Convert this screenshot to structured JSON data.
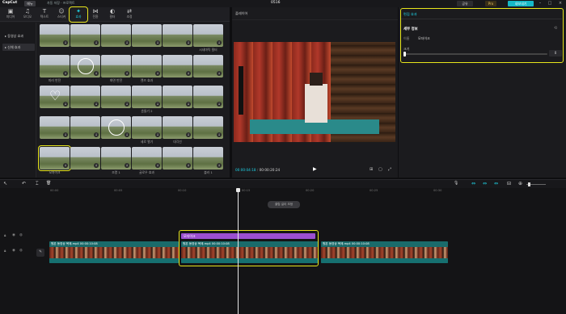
{
  "titlebar": {
    "app_name": "CapCut",
    "menu_label": "메뉴",
    "project_name": "자동 저장 · 프로젝트",
    "window_title": "0516",
    "share_label": "공유",
    "pro_label": "Pro",
    "export_label": "내보내기",
    "minimize": "–",
    "maximize": "□",
    "close": "×"
  },
  "media_tabs": [
    {
      "icon": "▣",
      "label": "미디어"
    },
    {
      "icon": "♫",
      "label": "오디오"
    },
    {
      "icon": "T",
      "label": "텍스트"
    },
    {
      "icon": "☺",
      "label": "스티커"
    },
    {
      "icon": "✦",
      "label": "효과"
    },
    {
      "icon": "⋈",
      "label": "전환"
    },
    {
      "icon": "◐",
      "label": "필터"
    },
    {
      "icon": "⇄",
      "label": "조정"
    }
  ],
  "sidebar": {
    "items": [
      {
        "label": "▸ 동영상 효과"
      },
      {
        "label": "▸ 신체 효과"
      }
    ]
  },
  "effects": [
    {
      "label": "",
      "style": "plain"
    },
    {
      "label": "",
      "style": "plain"
    },
    {
      "label": "",
      "style": "plain"
    },
    {
      "label": "",
      "style": "plain"
    },
    {
      "label": "",
      "style": "plain"
    },
    {
      "label": "시네마틱 필터",
      "style": "plain"
    },
    {
      "label": "미러 반전",
      "style": "plain"
    },
    {
      "label": "",
      "style": "circle"
    },
    {
      "label": "화면 반전",
      "style": "plain"
    },
    {
      "label": "렌즈 효과",
      "style": "plain"
    },
    {
      "label": "",
      "style": "plain"
    },
    {
      "label": "",
      "style": "plain"
    },
    {
      "label": "",
      "style": "heart"
    },
    {
      "label": "",
      "style": "plain"
    },
    {
      "label": "",
      "style": "plain"
    },
    {
      "label": "흔들기 2",
      "style": "plain"
    },
    {
      "label": "",
      "style": "plain"
    },
    {
      "label": "",
      "style": "plain"
    },
    {
      "label": "",
      "style": "plain"
    },
    {
      "label": "",
      "style": "plain"
    },
    {
      "label": "",
      "style": "circle"
    },
    {
      "label": "세로 열기",
      "style": "plain"
    },
    {
      "label": "대각선",
      "style": "plain"
    },
    {
      "label": "",
      "style": "plain"
    },
    {
      "label": "모자이크",
      "style": "plain"
    },
    {
      "label": "",
      "style": "plain"
    },
    {
      "label": "조명 1",
      "style": "plain"
    },
    {
      "label": "글로우 효과",
      "style": "plain"
    },
    {
      "label": "",
      "style": "plain"
    },
    {
      "label": "블러 1",
      "style": "plain"
    },
    {
      "label": "",
      "style": "plain"
    },
    {
      "label": "",
      "style": "plain"
    },
    {
      "label": "",
      "style": "plain"
    },
    {
      "label": "",
      "style": "plain"
    },
    {
      "label": "",
      "style": "plain"
    },
    {
      "label": "",
      "style": "plain"
    }
  ],
  "selected_effect_index": 24,
  "player": {
    "header": "플레이어",
    "current_time": "00:00:04:18",
    "total_time": "00:00:20:24",
    "play_icon": "▶"
  },
  "inspector": {
    "tab": "편집 효과",
    "section": "세부 정보",
    "name_key": "이름",
    "name_value": "모자이크",
    "param_label": "크기",
    "param_value": "0",
    "param_fraction": 0.0
  },
  "toolbar": {
    "select_icon": "↖",
    "undo_icon": "↶",
    "split_icon": "⌶",
    "delete_icon": "🗑",
    "mic_icon": "🎙",
    "zoom_icon": "⊕"
  },
  "ruler": [
    "00:00",
    "00:05",
    "00:10",
    "00:15",
    "00:20",
    "00:25",
    "00:30"
  ],
  "timeline_label": "클립 길이 조정",
  "effect_clip": "모자이크",
  "video_clips": [
    {
      "label": "원본 동영상 복제.mp4  00:00:10:08"
    },
    {
      "label": "원본 동영상 복제.mp4  00:00:10:08"
    },
    {
      "label": "원본 동영상 복제.mp4  00:00:10:08"
    }
  ],
  "colors": {
    "accent": "#1ed2e6",
    "highlight": "#e8e61c",
    "effect_clip": "#9b4fd0",
    "video_clip": "#1a6b6b"
  }
}
